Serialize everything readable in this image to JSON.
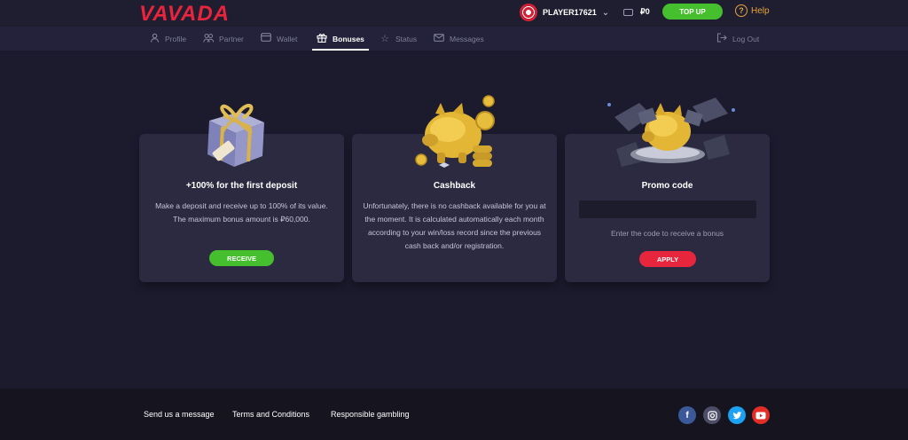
{
  "header": {
    "logo": "VAVADA",
    "username": "PLAYER17621",
    "balance": "₽0",
    "topup_label": "TOP UP",
    "help_label": "Help"
  },
  "nav": {
    "items": [
      {
        "label": "Profile",
        "icon": "user-icon"
      },
      {
        "label": "Partner",
        "icon": "partner-icon"
      },
      {
        "label": "Wallet",
        "icon": "wallet-icon"
      },
      {
        "label": "Bonuses",
        "icon": "gift-icon",
        "active": true
      },
      {
        "label": "Status",
        "icon": "star-icon"
      },
      {
        "label": "Messages",
        "icon": "envelope-icon"
      }
    ],
    "logout_label": "Log Out"
  },
  "cards": {
    "deposit": {
      "title": "+100% for the first deposit",
      "text": "Make a deposit and receive up to 100% of its value. The maximum bonus amount is ₽60,000.",
      "button": "RECEIVE"
    },
    "cashback": {
      "title": "Cashback",
      "text": "Unfortunately, there is no cashback available for you at the moment. It is calculated automatically each month according to your win/loss record since the previous cash back and/or registration."
    },
    "promo": {
      "title": "Promo code",
      "input_placeholder": "",
      "hint": "Enter the code to receive a bonus",
      "button": "APPLY"
    }
  },
  "footer": {
    "links": [
      "Send us a message",
      "Terms and Conditions",
      "Responsible gambling"
    ],
    "social": [
      "facebook-icon",
      "instagram-icon",
      "twitter-icon",
      "youtube-icon"
    ]
  },
  "colors": {
    "brand": "#e8253d",
    "accent_green": "#45bf2e",
    "help_orange": "#e6a43a",
    "background": "#1c1b2e",
    "card": "#2b2a40"
  }
}
